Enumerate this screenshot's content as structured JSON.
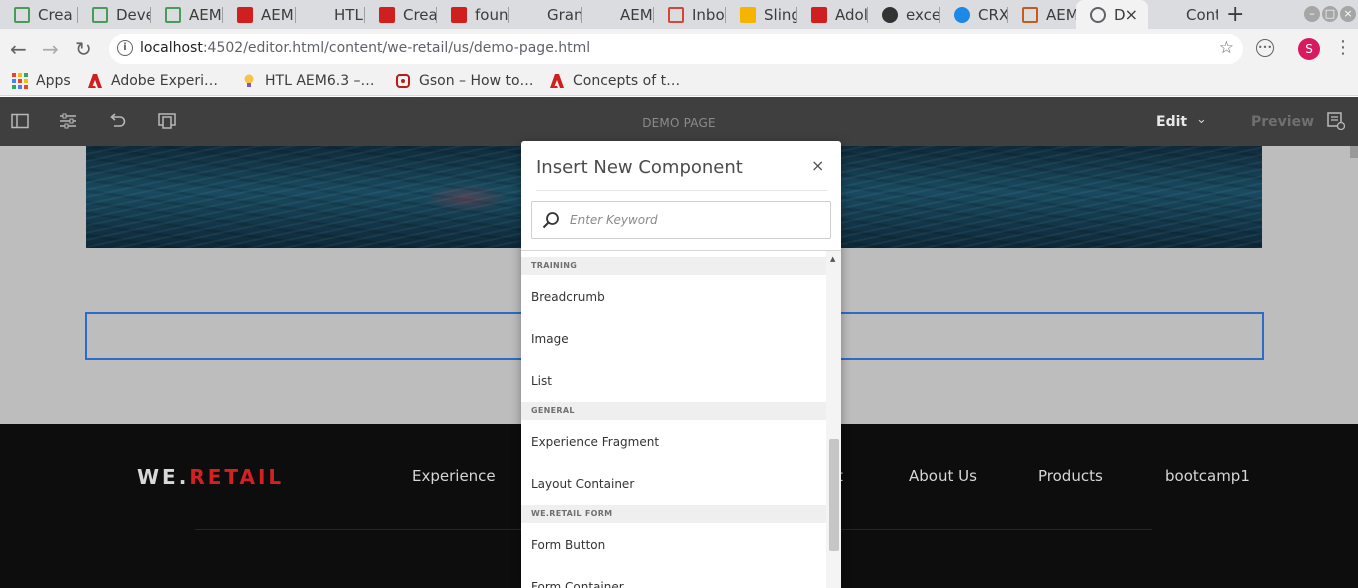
{
  "browser": {
    "tabs": [
      {
        "label": "Crea",
        "icon": "aem-crx-icon",
        "color": "#4a9b5a"
      },
      {
        "label": "Deve",
        "icon": "aem-crx-icon",
        "color": "#4a9b5a"
      },
      {
        "label": "AEM",
        "icon": "aem-crx-icon",
        "color": "#4a9b5a"
      },
      {
        "label": "AEM",
        "icon": "adobe-icon",
        "color": "#d01f1f"
      },
      {
        "label": "HTL",
        "icon": "page-icon",
        "color": "#9e9e9e"
      },
      {
        "label": "Crea",
        "icon": "adobe-icon",
        "color": "#d01f1f"
      },
      {
        "label": "foun",
        "icon": "adobe-icon",
        "color": "#d01f1f"
      },
      {
        "label": "Gran",
        "icon": "page-icon",
        "color": "#9e9e9e"
      },
      {
        "label": "AEM",
        "icon": "page-icon",
        "color": "#9e9e9e"
      },
      {
        "label": "Inbo",
        "icon": "gmail-icon",
        "color": "#d44638"
      },
      {
        "label": "Sling",
        "icon": "slides-icon",
        "color": "#f4b400"
      },
      {
        "label": "Adol",
        "icon": "adobe-icon",
        "color": "#d01f1f"
      },
      {
        "label": "exce",
        "icon": "github-icon",
        "color": "#333333"
      },
      {
        "label": "CRXI",
        "icon": "crx-globe-icon",
        "color": "#1e88e5"
      },
      {
        "label": "AEM",
        "icon": "aem-orange-icon",
        "color": "#c65c1c"
      },
      {
        "label": "D",
        "icon": "globe-icon",
        "color": "#5f6368"
      },
      {
        "label": "Cont",
        "icon": "page-icon",
        "color": "#9e9e9e"
      }
    ],
    "active_tab_close": "×",
    "new_tab": "+",
    "url_host": "localhost",
    "url_path": ":4502/editor.html/content/we-retail/us/demo-page.html",
    "avatar_letter": "S",
    "bookmarks": [
      {
        "label": "Apps",
        "icon": "apps-grid-icon"
      },
      {
        "label": "Adobe Experi…",
        "icon": "adobe-icon"
      },
      {
        "label": "HTL AEM6.3 –…",
        "icon": "lightbulb-icon"
      },
      {
        "label": "Gson – How to…",
        "icon": "gson-icon"
      },
      {
        "label": "Concepts of t…",
        "icon": "adobe-icon"
      }
    ]
  },
  "editor": {
    "page_title": "DEMO PAGE",
    "mode_label": "Edit",
    "preview_label": "Preview"
  },
  "site": {
    "brand_main": "WE.",
    "brand_accent": "RETAIL",
    "brand_accent_color": "#d42020",
    "footer_nav": [
      "Experience",
      "t",
      "About Us",
      "Products",
      "bootcamp1"
    ]
  },
  "dialog": {
    "title": "Insert New Component",
    "close": "×",
    "search_placeholder": "Enter Keyword",
    "groups": [
      {
        "name": "TRAINING",
        "items": [
          "Breadcrumb",
          "Image",
          "List"
        ]
      },
      {
        "name": "GENERAL",
        "items": [
          "Experience Fragment",
          "Layout Container"
        ]
      },
      {
        "name": "WE.RETAIL FORM",
        "items": [
          "Form Button",
          "Form Container"
        ]
      }
    ]
  }
}
